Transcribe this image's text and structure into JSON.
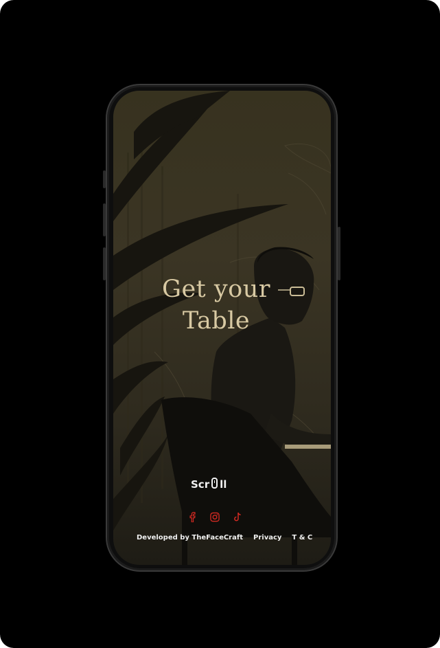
{
  "hero": {
    "headline_line1": "Get your",
    "headline_line2": "Table"
  },
  "scroll": {
    "prefix": "Scr",
    "suffix": "ll",
    "icon": "mouse-icon"
  },
  "socials": [
    {
      "name": "facebook",
      "icon": "facebook-icon"
    },
    {
      "name": "instagram",
      "icon": "instagram-icon"
    },
    {
      "name": "tiktok",
      "icon": "tiktok-icon"
    }
  ],
  "footer": {
    "developer_label": "Developed by TheFaceCraft",
    "privacy_label": "Privacy",
    "terms_label": "T & C"
  },
  "colors": {
    "frame": "#000000",
    "headline": "#d8c9a3",
    "social_accent": "#d62a22",
    "text": "#f0f0f0",
    "screen_bg": "#37321f"
  }
}
